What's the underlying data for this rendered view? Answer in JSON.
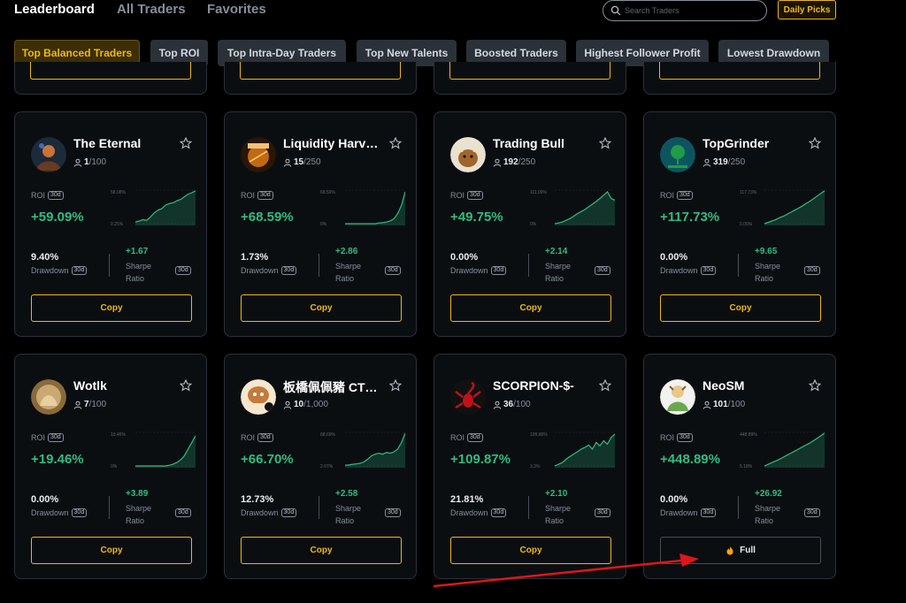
{
  "nav": {
    "tabs": [
      {
        "label": "Leaderboard"
      },
      {
        "label": "All Traders"
      },
      {
        "label": "Favorites"
      }
    ],
    "search_placeholder": "Search Traders",
    "daily_picks": "Daily Picks"
  },
  "filters": [
    {
      "label": "Top Balanced Traders",
      "active": true
    },
    {
      "label": "Top ROI"
    },
    {
      "label": "Top Intra-Day Traders"
    },
    {
      "label": "Top New Talents"
    },
    {
      "label": "Boosted Traders"
    },
    {
      "label": "Highest Follower Profit"
    },
    {
      "label": "Lowest Drawdown"
    }
  ],
  "labels": {
    "roi": "ROI",
    "period": "30d",
    "drawdown": "Drawdown",
    "sharpe_line1": "Sharpe",
    "sharpe_line2": "Ratio"
  },
  "colors": {
    "accent": "#f0b90b",
    "positive": "#2ebd85",
    "card_bg": "#0b0e11",
    "annotation_arrow": "#e0151a"
  },
  "cards": [
    {
      "name": "The Eternal",
      "followers": "1",
      "capacity": "/100",
      "roi": "+59.09%",
      "roi_hi": "58.08%",
      "roi_lo": "0.25%",
      "drawdown": "9.40%",
      "sharpe": "+1.67",
      "button": "Copy",
      "avatar_icon": "warrior-avatar-icon",
      "trend": [
        0.05,
        0.08,
        0.12,
        0.1,
        0.2,
        0.32,
        0.4,
        0.45,
        0.55,
        0.6,
        0.62,
        0.68,
        0.72,
        0.8,
        0.88,
        0.92,
        0.98
      ]
    },
    {
      "name": "Liquidity Harv…",
      "followers": "15",
      "capacity": "/250",
      "roi": "+68.59%",
      "roi_hi": "68.59%",
      "roi_lo": "0%",
      "drawdown": "1.73%",
      "sharpe": "+2.86",
      "button": "Copy",
      "avatar_icon": "harvester-logo-icon",
      "trend": [
        0,
        0,
        0,
        0,
        0,
        0,
        0,
        0,
        0,
        0.02,
        0.03,
        0.05,
        0.08,
        0.15,
        0.3,
        0.55,
        0.95
      ]
    },
    {
      "name": "Trading Bull",
      "followers": "192",
      "capacity": "/250",
      "roi": "+49.75%",
      "roi_hi": "111.09%",
      "roi_lo": "0%",
      "drawdown": "0.00%",
      "sharpe": "+2.14",
      "button": "Copy",
      "avatar_icon": "bull-avatar-icon",
      "trend": [
        0,
        0.02,
        0.05,
        0.1,
        0.15,
        0.22,
        0.3,
        0.36,
        0.42,
        0.5,
        0.58,
        0.66,
        0.75,
        0.85,
        0.95,
        0.75,
        0.7
      ]
    },
    {
      "name": "TopGrinder",
      "followers": "319",
      "capacity": "/250",
      "roi": "+117.73%",
      "roi_hi": "117.73%",
      "roi_lo": "0.00%",
      "drawdown": "0.00%",
      "sharpe": "+9.65",
      "button": "Copy",
      "avatar_icon": "grinder-logo-icon",
      "trend": [
        0,
        0.04,
        0.08,
        0.12,
        0.18,
        0.22,
        0.28,
        0.34,
        0.4,
        0.46,
        0.52,
        0.6,
        0.66,
        0.74,
        0.82,
        0.9,
        0.98
      ]
    },
    {
      "name": "Wotlk",
      "followers": "7",
      "capacity": "/100",
      "roi": "+19.46%",
      "roi_hi": "19.45%",
      "roi_lo": "0%",
      "drawdown": "0.00%",
      "sharpe": "+3.89",
      "button": "Copy",
      "avatar_icon": "sepia-avatar-icon",
      "trend": [
        0,
        0,
        0,
        0,
        0,
        0,
        0,
        0,
        0,
        0.02,
        0.05,
        0.1,
        0.18,
        0.3,
        0.5,
        0.7,
        0.9
      ]
    },
    {
      "name": "板橋佩佩豬 CT…",
      "followers": "10",
      "capacity": "/1,000",
      "roi": "+66.70%",
      "roi_hi": "68.69%",
      "roi_lo": "2.67%",
      "drawdown": "12.73%",
      "sharpe": "+2.58",
      "button": "Copy",
      "avatar_icon": "pig-avatar-icon",
      "trend": [
        0.02,
        0.03,
        0.05,
        0.06,
        0.08,
        0.12,
        0.2,
        0.3,
        0.35,
        0.38,
        0.35,
        0.4,
        0.38,
        0.42,
        0.5,
        0.7,
        0.98
      ]
    },
    {
      "name": "SCORPION-$-",
      "followers": "36",
      "capacity": "/100",
      "roi": "+109.87%",
      "roi_hi": "109.86%",
      "roi_lo": "3.3%",
      "drawdown": "21.81%",
      "sharpe": "+2.10",
      "button": "Copy",
      "avatar_icon": "scorpion-avatar-icon",
      "trend": [
        0,
        0.05,
        0.1,
        0.2,
        0.28,
        0.35,
        0.42,
        0.5,
        0.55,
        0.62,
        0.5,
        0.7,
        0.6,
        0.75,
        0.65,
        0.85,
        0.95
      ]
    },
    {
      "name": "NeoSM",
      "followers": "101",
      "capacity": "/100",
      "roi": "+448.89%",
      "roi_hi": "448.89%",
      "roi_lo": "5.18%",
      "drawdown": "0.00%",
      "sharpe": "+26.92",
      "button": "Full",
      "avatar_icon": "monk-avatar-icon",
      "full": true,
      "trend": [
        0,
        0.05,
        0.1,
        0.15,
        0.2,
        0.26,
        0.32,
        0.38,
        0.44,
        0.5,
        0.56,
        0.62,
        0.68,
        0.75,
        0.82,
        0.9,
        0.98
      ]
    }
  ]
}
